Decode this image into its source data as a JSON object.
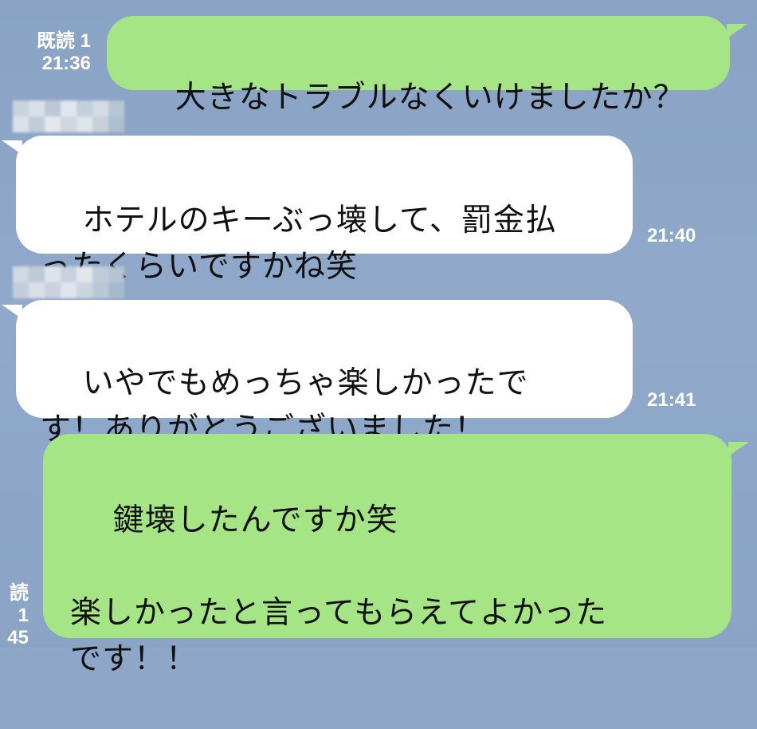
{
  "messages": [
    {
      "side": "sent",
      "text": "大きなトラブルなくいけましたか？",
      "read": "既読 1",
      "time": "21:36"
    },
    {
      "side": "received",
      "text": "ホテルのキーぶっ壊して、罰金払\nったくらいですかね笑",
      "time": "21:40"
    },
    {
      "side": "received",
      "text": "いやでもめっちゃ楽しかったで\nす！ありがとうございました！",
      "time": "21:41"
    },
    {
      "side": "sent",
      "text": "鍵壊したんですか笑\n\n楽しかったと言ってもらえてよかった\nです！！",
      "read": "読 1",
      "time": "45"
    }
  ],
  "colors": {
    "background": "#8ea7c8",
    "sent_bubble": "#a6e586",
    "received_bubble": "#ffffff",
    "meta_text": "#ffffff"
  }
}
